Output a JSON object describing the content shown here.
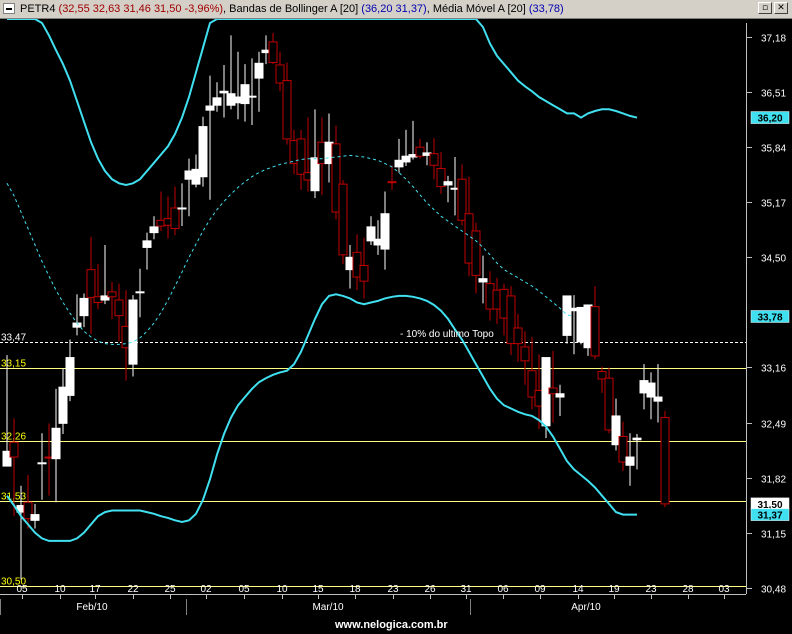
{
  "window": {
    "ticker": "PETR4",
    "ohlc": "(32,55  32,63  31,46  31,50  -3,96%)",
    "bb_label": "Bandas de Bollinger A [20]",
    "bb_values": "(36,20  31,37)",
    "ma_label": "Média Móvel A [20]",
    "ma_values": "(33,78)",
    "restore_glyph": "▫",
    "close_glyph": "✕"
  },
  "footer": {
    "watermark": "www.nelogica.com.br"
  },
  "colors": {
    "background": "#000000",
    "candle_up": "#ffffff",
    "candle_down": "#c00000",
    "bollinger": "#40e0f0",
    "moving_average": "#40e0f0",
    "support_lines": "#ffff80",
    "level_labels": "#ffff00",
    "axis_text": "#ffffff"
  },
  "chart_data": {
    "type": "candlestick",
    "x_tick_labels": [
      "05",
      "10",
      "17",
      "22",
      "25",
      "02",
      "05",
      "10",
      "15",
      "18",
      "23",
      "26",
      "31",
      "06",
      "09",
      "14",
      "19",
      "23",
      "28",
      "03"
    ],
    "month_labels": [
      "Feb/10",
      "Mar/10",
      "Apr/10"
    ],
    "y_ticks": [
      "37,18",
      "36,51",
      "35,84",
      "35,17",
      "34,50",
      "33,16",
      "32,49",
      "31,82",
      "31,15",
      "30,48"
    ],
    "ylim": [
      30.48,
      37.5
    ],
    "last_price_label": "31,50",
    "bb_upper_label": "36,20",
    "bb_lower_label": "31,37",
    "ma_label": "33,78",
    "candles": [
      [
        31.96,
        33.31,
        31.96,
        32.14
      ],
      [
        32.25,
        32.54,
        31.35,
        32.07
      ],
      [
        31.4,
        31.72,
        30.58,
        31.48
      ],
      [
        31.52,
        31.85,
        31.2,
        31.32
      ],
      [
        31.3,
        31.5,
        31.2,
        31.37
      ],
      [
        32.0,
        32.36,
        31.55,
        32.0
      ],
      [
        32.07,
        32.48,
        31.6,
        32.06
      ],
      [
        32.05,
        32.9,
        31.52,
        32.42
      ],
      [
        32.48,
        33.15,
        32.35,
        32.92
      ],
      [
        32.82,
        33.5,
        32.75,
        33.28
      ],
      [
        33.65,
        34.05,
        33.55,
        33.7
      ],
      [
        33.79,
        34.06,
        33.65,
        34.0
      ],
      [
        34.35,
        34.75,
        33.57,
        34.01
      ],
      [
        34.02,
        34.42,
        33.87,
        33.95
      ],
      [
        33.98,
        34.65,
        33.93,
        34.03
      ],
      [
        34.08,
        34.2,
        33.75,
        34.02
      ],
      [
        33.98,
        34.18,
        33.48,
        33.79
      ],
      [
        33.66,
        34.1,
        33.0,
        33.4
      ],
      [
        33.2,
        34.04,
        33.05,
        33.98
      ],
      [
        34.08,
        34.36,
        33.77,
        34.08
      ],
      [
        34.62,
        34.8,
        34.35,
        34.7
      ],
      [
        34.8,
        35.0,
        34.72,
        34.87
      ],
      [
        34.95,
        35.3,
        34.82,
        34.88
      ],
      [
        34.97,
        35.24,
        34.73,
        34.89
      ],
      [
        35.1,
        35.36,
        34.77,
        34.85
      ],
      [
        35.1,
        35.4,
        34.88,
        35.1
      ],
      [
        35.45,
        35.7,
        35.0,
        35.55
      ],
      [
        35.39,
        35.75,
        35.35,
        35.57
      ],
      [
        35.48,
        36.21,
        35.36,
        36.09
      ],
      [
        36.29,
        36.71,
        35.2,
        36.34
      ],
      [
        36.35,
        36.63,
        36.27,
        36.44
      ],
      [
        36.5,
        36.84,
        36.2,
        36.52
      ],
      [
        36.35,
        37.2,
        36.3,
        36.49
      ],
      [
        36.38,
        37.0,
        36.18,
        36.45
      ],
      [
        36.37,
        36.85,
        36.15,
        36.6
      ],
      [
        36.45,
        36.92,
        36.11,
        36.46
      ],
      [
        36.68,
        37.0,
        36.27,
        36.86
      ],
      [
        36.99,
        37.2,
        36.85,
        37.02
      ],
      [
        37.12,
        37.23,
        36.85,
        36.87
      ],
      [
        36.84,
        37.0,
        36.52,
        36.62
      ],
      [
        36.65,
        36.87,
        35.87,
        35.94
      ],
      [
        35.92,
        36.05,
        35.51,
        35.64
      ],
      [
        35.94,
        36.05,
        35.32,
        35.51
      ],
      [
        35.53,
        36.2,
        35.3,
        35.44
      ],
      [
        35.31,
        36.3,
        35.22,
        35.71
      ],
      [
        35.9,
        36.2,
        35.26,
        35.64
      ],
      [
        35.64,
        36.25,
        35.41,
        35.9
      ],
      [
        35.88,
        36.1,
        34.96,
        35.05
      ],
      [
        35.39,
        35.44,
        34.42,
        34.53
      ],
      [
        34.35,
        34.65,
        34.12,
        34.5
      ],
      [
        34.56,
        34.78,
        34.1,
        34.26
      ],
      [
        34.4,
        34.74,
        34.0,
        34.21
      ],
      [
        34.7,
        35.0,
        34.65,
        34.87
      ],
      [
        34.65,
        34.95,
        34.53,
        34.72
      ],
      [
        34.6,
        35.3,
        34.35,
        35.03
      ],
      [
        35.42,
        35.62,
        35.32,
        35.41
      ],
      [
        35.6,
        35.94,
        35.53,
        35.68
      ],
      [
        35.66,
        36.05,
        35.61,
        35.73
      ],
      [
        35.72,
        36.16,
        35.69,
        35.75
      ],
      [
        35.84,
        35.94,
        35.7,
        35.73
      ],
      [
        35.74,
        35.9,
        35.62,
        35.77
      ],
      [
        35.76,
        35.95,
        35.45,
        35.62
      ],
      [
        35.58,
        35.78,
        35.27,
        35.36
      ],
      [
        35.38,
        35.49,
        35.17,
        35.42
      ],
      [
        35.33,
        35.72,
        35.01,
        35.34
      ],
      [
        35.45,
        35.63,
        34.89,
        34.95
      ],
      [
        35.03,
        35.48,
        34.27,
        34.43
      ],
      [
        34.82,
        34.92,
        34.06,
        34.28
      ],
      [
        34.2,
        34.52,
        33.94,
        34.24
      ],
      [
        34.18,
        34.33,
        33.73,
        33.87
      ],
      [
        34.1,
        34.25,
        33.69,
        33.87
      ],
      [
        34.11,
        34.18,
        33.55,
        33.76
      ],
      [
        34.03,
        34.15,
        33.31,
        33.45
      ],
      [
        33.64,
        33.81,
        33.23,
        33.45
      ],
      [
        33.41,
        33.6,
        32.95,
        33.24
      ],
      [
        33.12,
        33.53,
        32.65,
        32.8
      ],
      [
        32.88,
        33.32,
        32.41,
        32.69
      ],
      [
        32.45,
        33.25,
        32.3,
        33.28
      ],
      [
        32.91,
        33.36,
        32.49,
        32.84
      ],
      [
        32.8,
        32.95,
        32.57,
        32.84
      ],
      [
        33.55,
        33.9,
        33.45,
        34.03
      ],
      [
        33.85,
        34.04,
        33.32,
        33.88
      ],
      [
        33.47,
        33.75,
        33.44,
        33.89
      ],
      [
        33.4,
        33.71,
        33.3,
        33.92
      ],
      [
        33.9,
        34.15,
        33.26,
        33.3
      ],
      [
        33.11,
        33.17,
        32.85,
        33.02
      ],
      [
        33.03,
        33.16,
        32.36,
        32.4
      ],
      [
        32.22,
        32.78,
        32.15,
        32.57
      ],
      [
        32.32,
        32.5,
        31.9,
        32.01
      ],
      [
        31.97,
        32.36,
        31.72,
        32.07
      ],
      [
        32.28,
        32.35,
        31.92,
        32.3
      ],
      [
        32.85,
        33.2,
        32.65,
        33.0
      ],
      [
        32.8,
        33.1,
        32.53,
        32.97
      ],
      [
        32.75,
        33.2,
        32.49,
        32.8
      ],
      [
        32.55,
        32.63,
        31.46,
        31.5
      ]
    ],
    "bollinger_upper": [
      37.55,
      37.55,
      37.55,
      37.55,
      37.55,
      37.35,
      37.2,
      37.02,
      36.85,
      36.65,
      36.4,
      36.15,
      35.9,
      35.7,
      35.55,
      35.45,
      35.4,
      35.38,
      35.4,
      35.45,
      35.55,
      35.65,
      35.75,
      35.85,
      36.0,
      36.2,
      36.45,
      36.75,
      37.05,
      37.35,
      37.55,
      37.55,
      37.55,
      37.55,
      37.55,
      37.55,
      37.55,
      37.55,
      37.55,
      37.55,
      37.55,
      37.55,
      37.55,
      37.55,
      37.55,
      37.55,
      37.55,
      37.55,
      37.55,
      37.55,
      37.55,
      37.55,
      37.55,
      37.55,
      37.55,
      37.55,
      37.55,
      37.55,
      37.55,
      37.55,
      37.55,
      37.55,
      37.55,
      37.55,
      37.55,
      37.55,
      37.55,
      37.48,
      37.3,
      37.1,
      36.95,
      36.85,
      36.75,
      36.65,
      36.58,
      36.52,
      36.45,
      36.4,
      36.35,
      36.3,
      36.25,
      36.25,
      36.2,
      36.25,
      36.28,
      36.3,
      36.3,
      36.28,
      36.25,
      36.22,
      36.2
    ],
    "bollinger_lower": [
      31.6,
      31.48,
      31.35,
      31.25,
      31.15,
      31.08,
      31.05,
      31.05,
      31.05,
      31.05,
      31.08,
      31.15,
      31.25,
      31.35,
      31.4,
      31.42,
      31.42,
      31.42,
      31.42,
      31.42,
      31.4,
      31.38,
      31.35,
      31.33,
      31.3,
      31.28,
      31.3,
      31.38,
      31.55,
      31.8,
      32.1,
      32.35,
      32.55,
      32.7,
      32.8,
      32.9,
      32.98,
      33.03,
      33.07,
      33.1,
      33.12,
      33.2,
      33.35,
      33.55,
      33.75,
      33.93,
      34.03,
      34.05,
      34.03,
      34.0,
      33.95,
      33.93,
      33.95,
      33.97,
      34.0,
      34.02,
      34.03,
      34.03,
      34.02,
      34.0,
      33.97,
      33.92,
      33.85,
      33.75,
      33.62,
      33.5,
      33.35,
      33.2,
      33.05,
      32.9,
      32.78,
      32.7,
      32.66,
      32.62,
      32.59,
      32.57,
      32.52,
      32.44,
      32.32,
      32.17,
      32.02,
      31.92,
      31.85,
      31.78,
      31.7,
      31.6,
      31.5,
      31.4,
      31.37,
      31.37,
      31.37
    ],
    "moving_average": [
      35.4,
      35.25,
      35.05,
      34.85,
      34.65,
      34.45,
      34.27,
      34.1,
      33.95,
      33.82,
      33.7,
      33.6,
      33.53,
      33.48,
      33.45,
      33.44,
      33.44,
      33.45,
      33.47,
      33.52,
      33.6,
      33.7,
      33.83,
      33.98,
      34.15,
      34.32,
      34.5,
      34.66,
      34.82,
      34.96,
      35.08,
      35.18,
      35.27,
      35.35,
      35.42,
      35.48,
      35.53,
      35.57,
      35.6,
      35.63,
      35.65,
      35.67,
      35.69,
      35.7,
      35.7,
      35.7,
      35.71,
      35.72,
      35.73,
      35.74,
      35.73,
      35.72,
      35.7,
      35.68,
      35.64,
      35.6,
      35.53,
      35.45,
      35.36,
      35.26,
      35.16,
      35.08,
      35.0,
      34.94,
      34.88,
      34.82,
      34.76,
      34.7,
      34.62,
      34.53,
      34.43,
      34.35,
      34.3,
      34.25,
      34.2,
      34.15,
      34.09,
      34.02,
      33.95,
      33.88,
      33.8,
      33.78
    ]
  },
  "annotations": {
    "top_line_value": 33.47,
    "top_line_label": "33,47",
    "ten_pct_value": 33.15,
    "ten_pct_label": "33,15",
    "ten_pct_text": "- 10% do ultimo Topo",
    "support1_value": 32.26,
    "support1_label": "32,26",
    "support2_value": 31.53,
    "support2_label": "31,53",
    "bottom_line_value": 30.5,
    "bottom_line_label": "30,50"
  }
}
